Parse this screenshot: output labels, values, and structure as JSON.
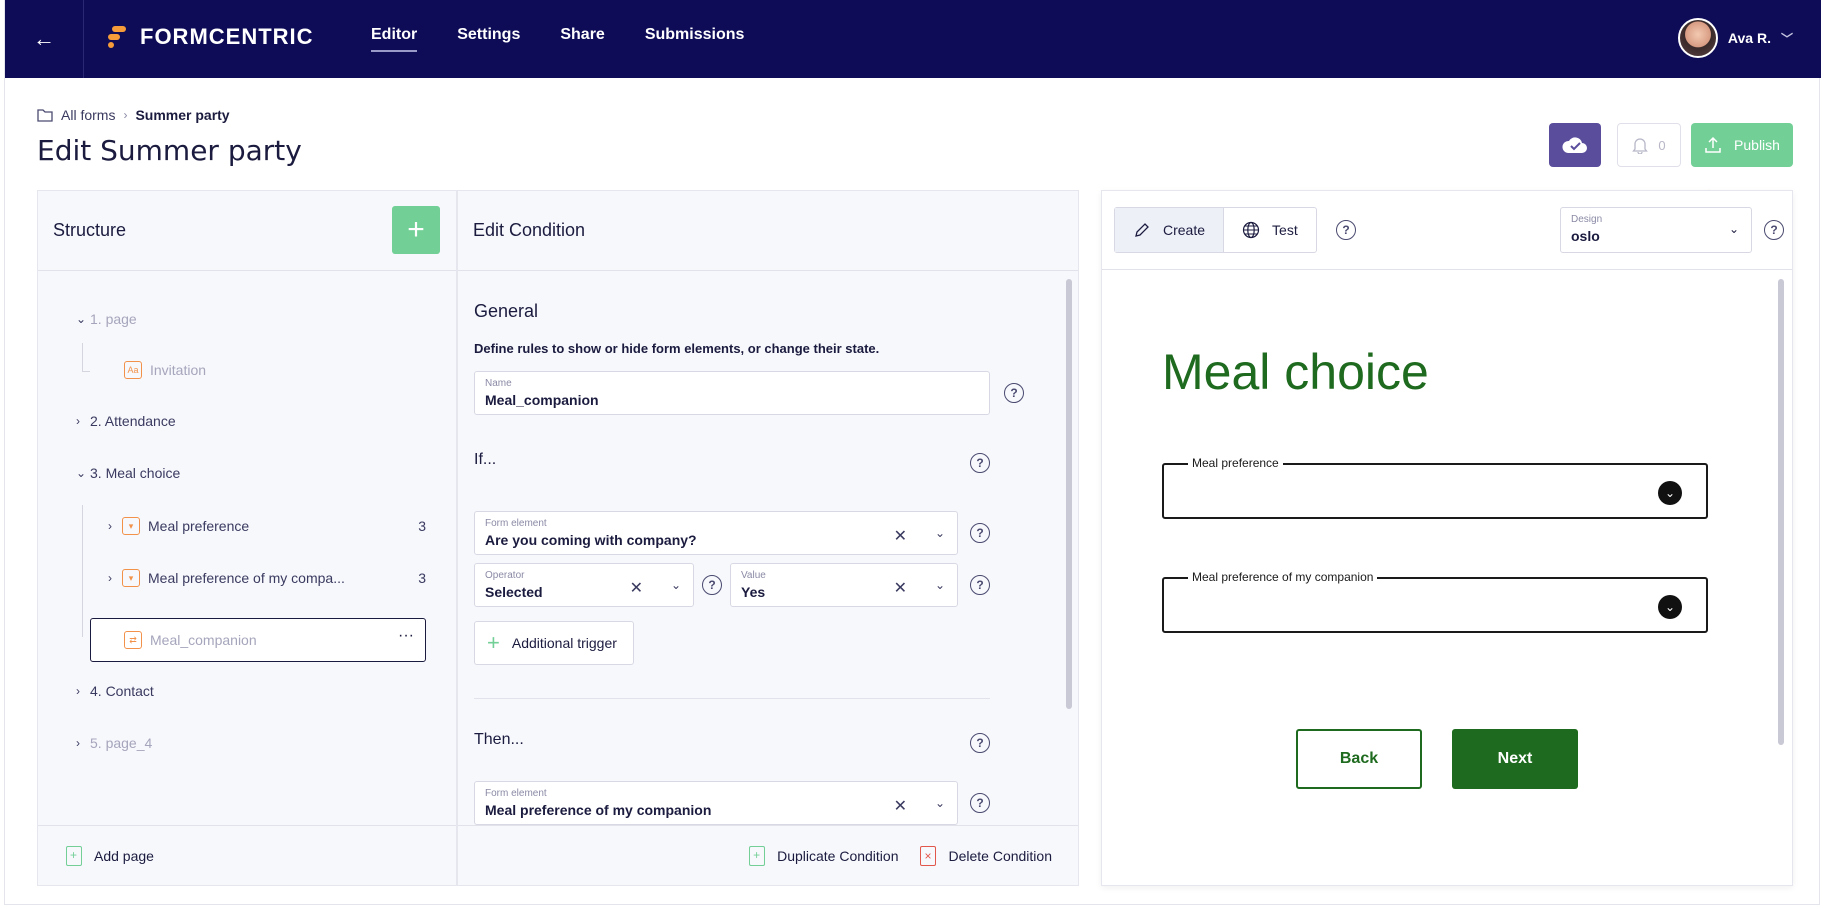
{
  "topbar": {
    "back_icon": "arrow-left-icon",
    "logo_text": "FORMCENTRIC",
    "nav": [
      "Editor",
      "Settings",
      "Share",
      "Submissions"
    ],
    "user_name": "Ava R."
  },
  "header": {
    "breadcrumb_root": "All forms",
    "breadcrumb_current": "Summer party",
    "title": "Edit Summer party",
    "notification_count": "0",
    "publish_label": "Publish"
  },
  "structure": {
    "title": "Structure",
    "add_label": "+",
    "nodes": [
      {
        "label": "1. page"
      },
      {
        "label": "Invitation"
      },
      {
        "label": "2. Attendance"
      },
      {
        "label": "3. Meal choice"
      },
      {
        "label": "Meal preference",
        "count": "3"
      },
      {
        "label": "Meal preference of my compa...",
        "count": "3"
      },
      {
        "label": "Meal_companion"
      },
      {
        "label": "4. Contact"
      },
      {
        "label": "5. page_4"
      }
    ],
    "more_label": "···",
    "add_page_label": "Add page"
  },
  "condition": {
    "title": "Edit Condition",
    "general_title": "General",
    "description": "Define rules to show or hide form elements, or change their state.",
    "name_label": "Name",
    "name_value": "Meal_companion",
    "if_title": "If...",
    "form_element_label": "Form element",
    "form_element_value": "Are you coming with company?",
    "operator_label": "Operator",
    "operator_value": "Selected",
    "value_label": "Value",
    "value_value": "Yes",
    "additional_trigger": "Additional trigger",
    "then_title": "Then...",
    "then_element_label": "Form element",
    "then_element_value": "Meal preference of my companion",
    "duplicate_label": "Duplicate Condition",
    "delete_label": "Delete Condition"
  },
  "preview": {
    "tab_create": "Create",
    "tab_test": "Test",
    "design_label": "Design",
    "design_value": "oslo",
    "page_title": "Meal choice",
    "select1_label": "Meal preference",
    "select2_label": "Meal preference of my companion",
    "back_label": "Back",
    "next_label": "Next"
  },
  "colors": {
    "topbar": "#0e0c57",
    "accent_green": "#72cf96",
    "save_purple": "#5a4d9c",
    "preview_green": "#1e6a1e",
    "annotation_orange": "#f0962e"
  }
}
